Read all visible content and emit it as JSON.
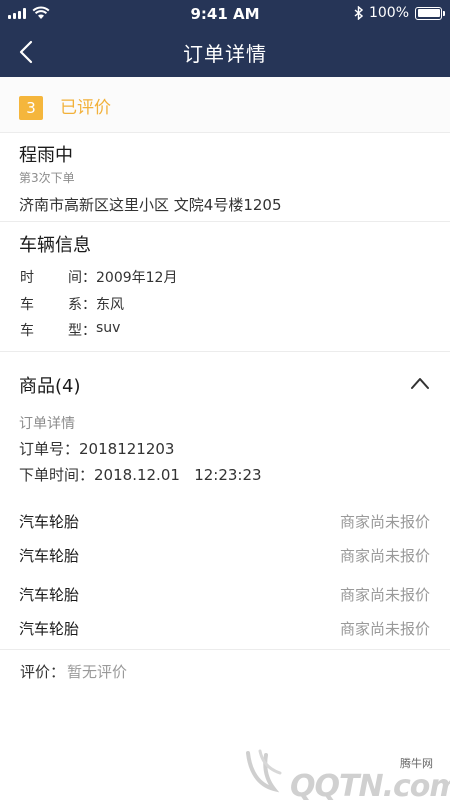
{
  "status_bar": {
    "time": "9:41 AM",
    "battery": "100%"
  },
  "nav": {
    "title": "订单详情"
  },
  "order_status": {
    "step": "3",
    "label": "已评价"
  },
  "customer": {
    "name": "程雨中",
    "order_count": "第3次下单",
    "address": "济南市高新区这里小区 文院4号楼1205"
  },
  "vehicle": {
    "title": "车辆信息",
    "rows": [
      {
        "k1": "时",
        "k2": "间",
        "value": "2009年12月"
      },
      {
        "k1": "车",
        "k2": "系",
        "value": "东风"
      },
      {
        "k1": "车",
        "k2": "型",
        "value": "suv"
      }
    ]
  },
  "goods": {
    "title": "商品(4)",
    "order_detail_label": "订单详情",
    "order_no_label": "订单号：",
    "order_no": "2018121203",
    "order_time_label": "下单时间：",
    "order_time": "2018.12.01   12:23:23",
    "items": [
      {
        "name": "汽车轮胎",
        "status": "商家尚未报价"
      },
      {
        "name": "汽车轮胎",
        "status": "商家尚未报价"
      },
      {
        "name": "汽车轮胎",
        "status": "商家尚未报价"
      },
      {
        "name": "汽车轮胎",
        "status": "商家尚未报价"
      }
    ]
  },
  "rating": {
    "label": "评价：",
    "value": "暂无评价"
  },
  "watermark": {
    "site_cn": "腾牛网",
    "logo_text": "QQTN.com"
  },
  "colors": {
    "header_bg": "#263557",
    "accent": "#f2b13a"
  }
}
